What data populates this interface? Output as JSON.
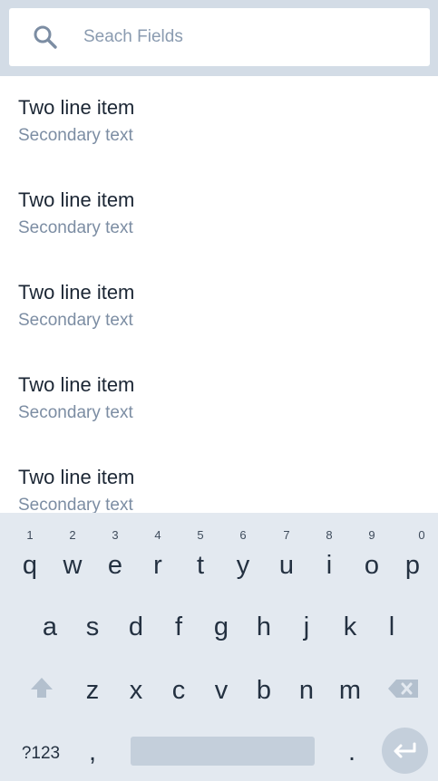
{
  "search": {
    "placeholder": "Seach Fields",
    "icon": "search-icon"
  },
  "list": {
    "items": [
      {
        "primary": "Two line item",
        "secondary": "Secondary text"
      },
      {
        "primary": "Two line item",
        "secondary": "Secondary text"
      },
      {
        "primary": "Two line item",
        "secondary": "Secondary text"
      },
      {
        "primary": "Two line item",
        "secondary": "Secondary text"
      },
      {
        "primary": "Two line item",
        "secondary": "Secondary text"
      }
    ]
  },
  "keyboard": {
    "row1": [
      {
        "label": "q",
        "hint": "1"
      },
      {
        "label": "w",
        "hint": "2"
      },
      {
        "label": "e",
        "hint": "3"
      },
      {
        "label": "r",
        "hint": "4"
      },
      {
        "label": "t",
        "hint": "5"
      },
      {
        "label": "y",
        "hint": "6"
      },
      {
        "label": "u",
        "hint": "7"
      },
      {
        "label": "i",
        "hint": "8"
      },
      {
        "label": "o",
        "hint": "9"
      },
      {
        "label": "p",
        "hint": "0"
      }
    ],
    "row2": [
      "a",
      "s",
      "d",
      "f",
      "g",
      "h",
      "j",
      "k",
      "l"
    ],
    "row3": [
      "z",
      "x",
      "c",
      "v",
      "b",
      "n",
      "m"
    ],
    "symbols_label": "?123",
    "comma": ",",
    "period": ".",
    "shift_icon": "shift-icon",
    "backspace_icon": "backspace-icon",
    "enter_icon": "enter-icon",
    "colors": {
      "background": "#e3e9f0",
      "key_fill": "#c4cfdb",
      "text": "#243141"
    }
  }
}
